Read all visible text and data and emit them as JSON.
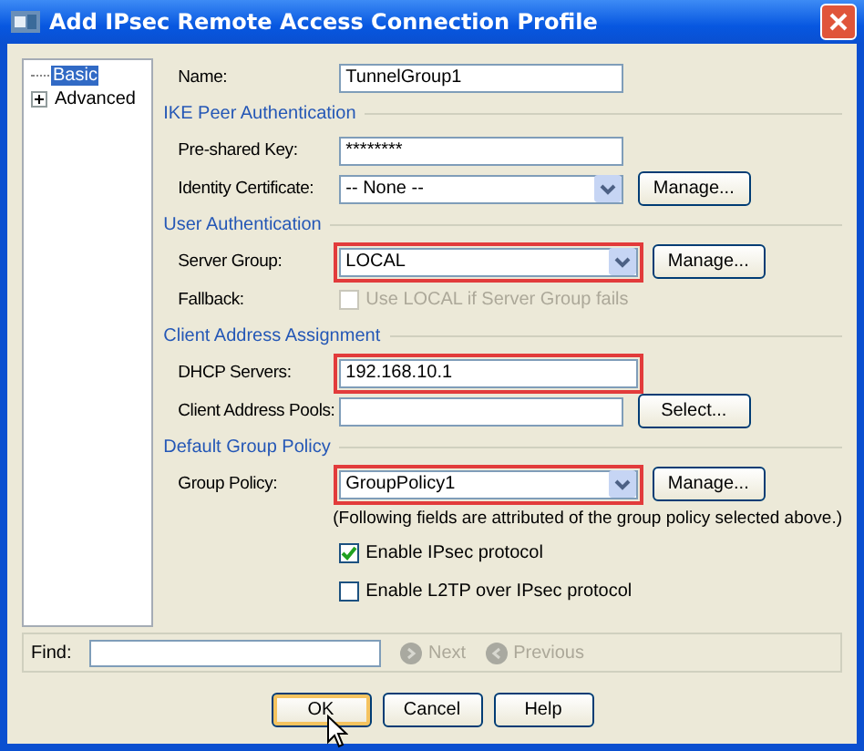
{
  "window": {
    "title": "Add IPsec Remote Access Connection Profile"
  },
  "tree": [
    {
      "label": "Basic",
      "kind": "leaf",
      "selected": true
    },
    {
      "label": "Advanced",
      "kind": "branch",
      "selected": false
    }
  ],
  "name_row": {
    "label": "Name:",
    "value": "TunnelGroup1"
  },
  "sections": [
    {
      "title": "IKE Peer Authentication",
      "rows": [
        {
          "kind": "text",
          "label": "Pre-shared Key:",
          "value": "********",
          "highlighted": false
        },
        {
          "kind": "dropdown",
          "label": "Identity Certificate:",
          "value": "-- None --",
          "highlighted": false,
          "button": "Manage..."
        }
      ]
    },
    {
      "title": "User Authentication",
      "rows": [
        {
          "kind": "dropdown",
          "label": "Server Group:",
          "value": "LOCAL",
          "highlighted": true,
          "button": "Manage..."
        },
        {
          "kind": "checkbox",
          "label": "Fallback:",
          "text": "Use LOCAL if Server Group fails",
          "checked": false,
          "disabled": true
        }
      ]
    },
    {
      "title": "Client Address Assignment",
      "rows": [
        {
          "kind": "text",
          "label": "DHCP Servers:",
          "value": "192.168.10.1",
          "highlighted": true
        },
        {
          "kind": "text",
          "label": "Client Address Pools:",
          "value": "",
          "highlighted": false,
          "button": "Select..."
        }
      ]
    },
    {
      "title": "Default Group Policy",
      "rows": [
        {
          "kind": "dropdown",
          "label": "Group Policy:",
          "value": "GroupPolicy1",
          "highlighted": true,
          "button": "Manage..."
        },
        {
          "kind": "note",
          "text": "(Following fields are attributed of the group policy selected above.)"
        },
        {
          "kind": "checkbox",
          "text": "Enable IPsec protocol",
          "checked": true,
          "disabled": false
        },
        {
          "kind": "checkbox",
          "text": "Enable L2TP over IPsec protocol",
          "checked": false,
          "disabled": false
        }
      ]
    }
  ],
  "find": {
    "label": "Find:",
    "next": "Next",
    "previous": "Previous",
    "disabled": true
  },
  "buttons": [
    {
      "label": "OK",
      "focused": true
    },
    {
      "label": "Cancel",
      "focused": false
    },
    {
      "label": "Help",
      "focused": false
    }
  ]
}
